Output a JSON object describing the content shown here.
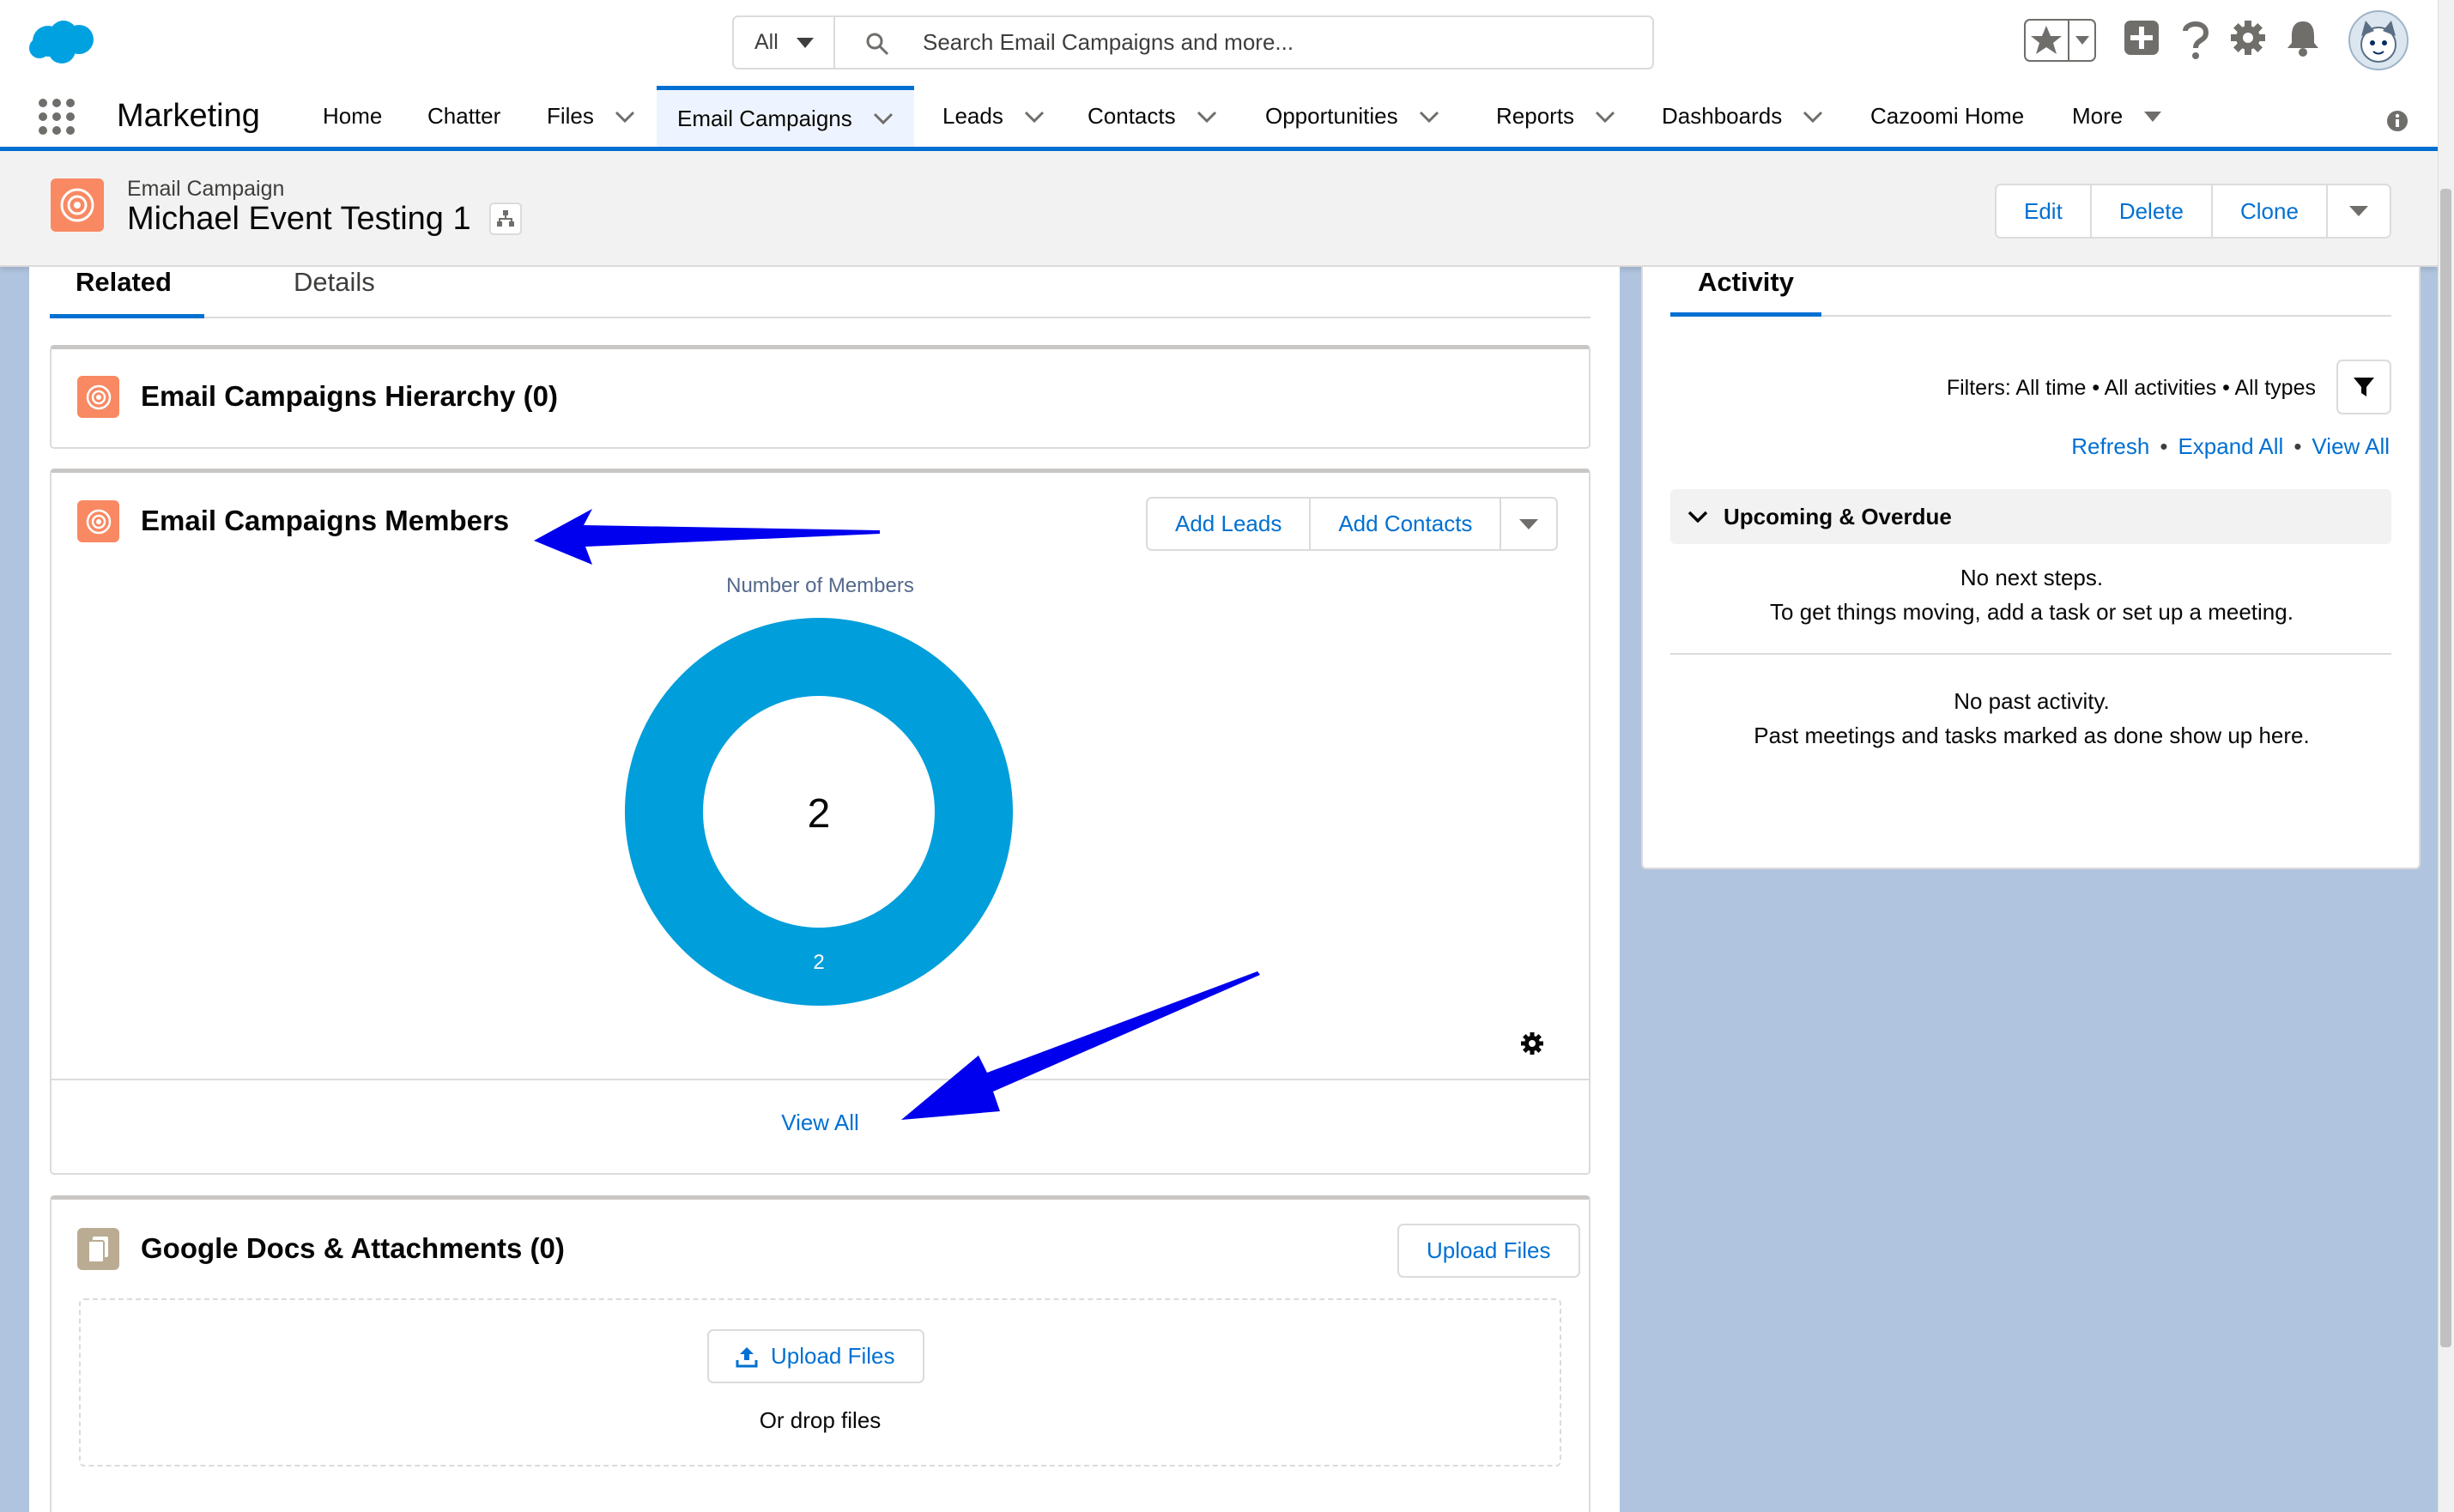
{
  "search": {
    "scope": "All",
    "placeholder": "Search Email Campaigns and more..."
  },
  "nav": {
    "app_name": "Marketing",
    "items": [
      {
        "label": "Home"
      },
      {
        "label": "Chatter"
      },
      {
        "label": "Files"
      },
      {
        "label": "Email Campaigns"
      },
      {
        "label": "Leads"
      },
      {
        "label": "Contacts"
      },
      {
        "label": "Opportunities"
      },
      {
        "label": "Reports"
      },
      {
        "label": "Dashboards"
      },
      {
        "label": "Cazoomi Home"
      },
      {
        "label": "More"
      }
    ]
  },
  "record": {
    "type": "Email Campaign",
    "title": "Michael Event Testing 1",
    "actions": {
      "edit": "Edit",
      "delete": "Delete",
      "clone": "Clone"
    }
  },
  "tabs": {
    "related": "Related",
    "details": "Details"
  },
  "hierarchy_card": {
    "title": "Email Campaigns Hierarchy (0)"
  },
  "members_card": {
    "title": "Email Campaigns Members",
    "add_leads": "Add Leads",
    "add_contacts": "Add Contacts",
    "chart_title": "Number of Members",
    "view_all": "View All"
  },
  "chart_data": {
    "type": "pie",
    "title": "Number of Members",
    "total": 2,
    "slices": [
      {
        "value": 2,
        "label": "2",
        "color": "#009edb"
      }
    ]
  },
  "files_card": {
    "title": "Google Docs & Attachments (0)",
    "upload_button": "Upload Files",
    "inner_upload": "Upload Files",
    "drop_text": "Or drop files"
  },
  "activity": {
    "tab": "Activity",
    "filters": "Filters: All time • All activities • All types",
    "refresh": "Refresh",
    "expand_all": "Expand All",
    "view_all": "View All",
    "section": "Upcoming & Overdue",
    "no_next_1": "No next steps.",
    "no_next_2": "To get things moving, add a task or set up a meeting.",
    "no_past_1": "No past activity.",
    "no_past_2": "Past meetings and tasks marked as done show up here."
  },
  "colors": {
    "brand": "#0070d2",
    "donut": "#009edb",
    "campaign_icon": "#f88962",
    "arrow": "#0000ee"
  }
}
